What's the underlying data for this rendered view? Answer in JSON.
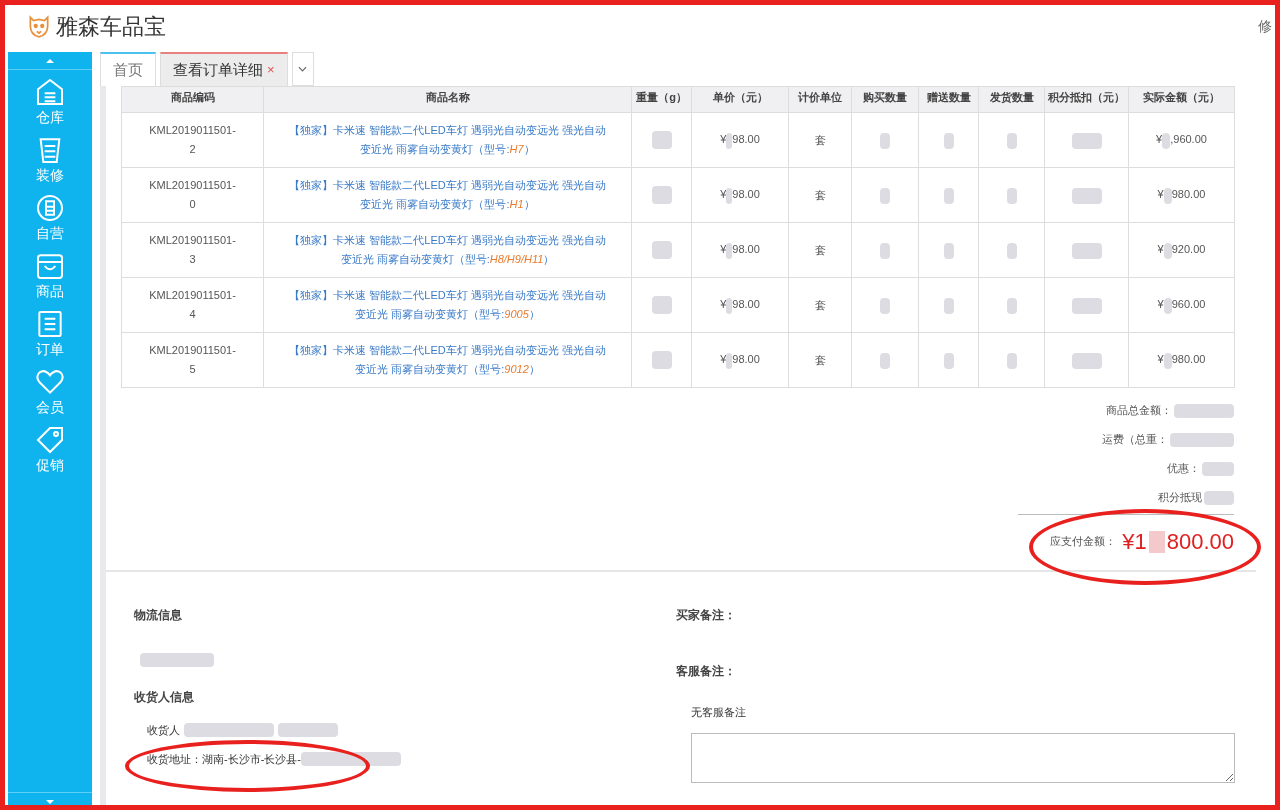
{
  "header": {
    "app_name": "雅森车品宝",
    "top_right": "修"
  },
  "sidebar": {
    "items": [
      {
        "label": "仓库",
        "kind": "warehouse"
      },
      {
        "label": "装修",
        "kind": "decor"
      },
      {
        "label": "自营",
        "kind": "self"
      },
      {
        "label": "商品",
        "kind": "goods"
      },
      {
        "label": "订单",
        "kind": "orders"
      },
      {
        "label": "会员",
        "kind": "members"
      },
      {
        "label": "促销",
        "kind": "promo"
      }
    ]
  },
  "tabs": [
    {
      "label": "首页",
      "selected": false
    },
    {
      "label": "查看订单详细",
      "selected": true,
      "close": "×"
    }
  ],
  "table": {
    "columns": [
      "商品编码",
      "商品名称",
      "重量（g）",
      "单价（元）",
      "计价单位",
      "购买数量",
      "赠送数量",
      "发货数量",
      "积分抵扣（元）",
      "实际金额（元）"
    ],
    "rows": [
      {
        "code": "KML2019011501-2",
        "name": "【独家】卡米速 智能款二代LED车灯 遇弱光自动变远光 强光自动变近光 雨雾自动变黄灯（型号:*H7*）",
        "price_prefix": "¥",
        "price_suffix": "98.00",
        "unit": "套",
        "amount_prefix": "¥",
        "amount_suffix": ",960.00"
      },
      {
        "code": "KML2019011501-0",
        "name": "【独家】卡米速 智能款二代LED车灯 遇弱光自动变远光 强光自动变近光 雨雾自动变黄灯（型号:*H1*）",
        "price_prefix": "¥",
        "price_suffix": "98.00",
        "unit": "套",
        "amount_prefix": "¥",
        "amount_suffix": "980.00"
      },
      {
        "code": "KML2019011501-3",
        "name": "【独家】卡米速 智能款二代LED车灯 遇弱光自动变远光 强光自动变近光 雨雾自动变黄灯（型号:*H8/H9/H11*）",
        "price_prefix": "¥",
        "price_suffix": "98.00",
        "unit": "套",
        "amount_prefix": "¥",
        "amount_suffix": "920.00"
      },
      {
        "code": "KML2019011501-4",
        "name": "【独家】卡米速 智能款二代LED车灯 遇弱光自动变远光 强光自动变近光 雨雾自动变黄灯（型号:*9005*）",
        "price_prefix": "¥",
        "price_suffix": "98.00",
        "unit": "套",
        "amount_prefix": "¥",
        "amount_suffix": "960.00"
      },
      {
        "code": "KML2019011501-5",
        "name": "【独家】卡米速 智能款二代LED车灯 遇弱光自动变远光 强光自动变近光 雨雾自动变黄灯（型号:*9012*）",
        "price_prefix": "¥",
        "price_suffix": "98.00",
        "unit": "套",
        "amount_prefix": "¥",
        "amount_suffix": "980.00"
      }
    ]
  },
  "summary": {
    "lines": [
      "商品总金额：",
      "运费（总重：",
      "优惠：",
      "积分抵现"
    ],
    "payable_label": "应支付金额：",
    "payable_prefix": "¥1",
    "payable_suffix": "800.00"
  },
  "logistics": {
    "title": "物流信息"
  },
  "consignee": {
    "title": "收货人信息",
    "name_label": "收货人",
    "address": "收货地址：湖南-长沙市-长沙县-"
  },
  "buyer_note": {
    "title": "买家备注："
  },
  "service_note": {
    "title": "客服备注：",
    "text": "无客服备注"
  }
}
